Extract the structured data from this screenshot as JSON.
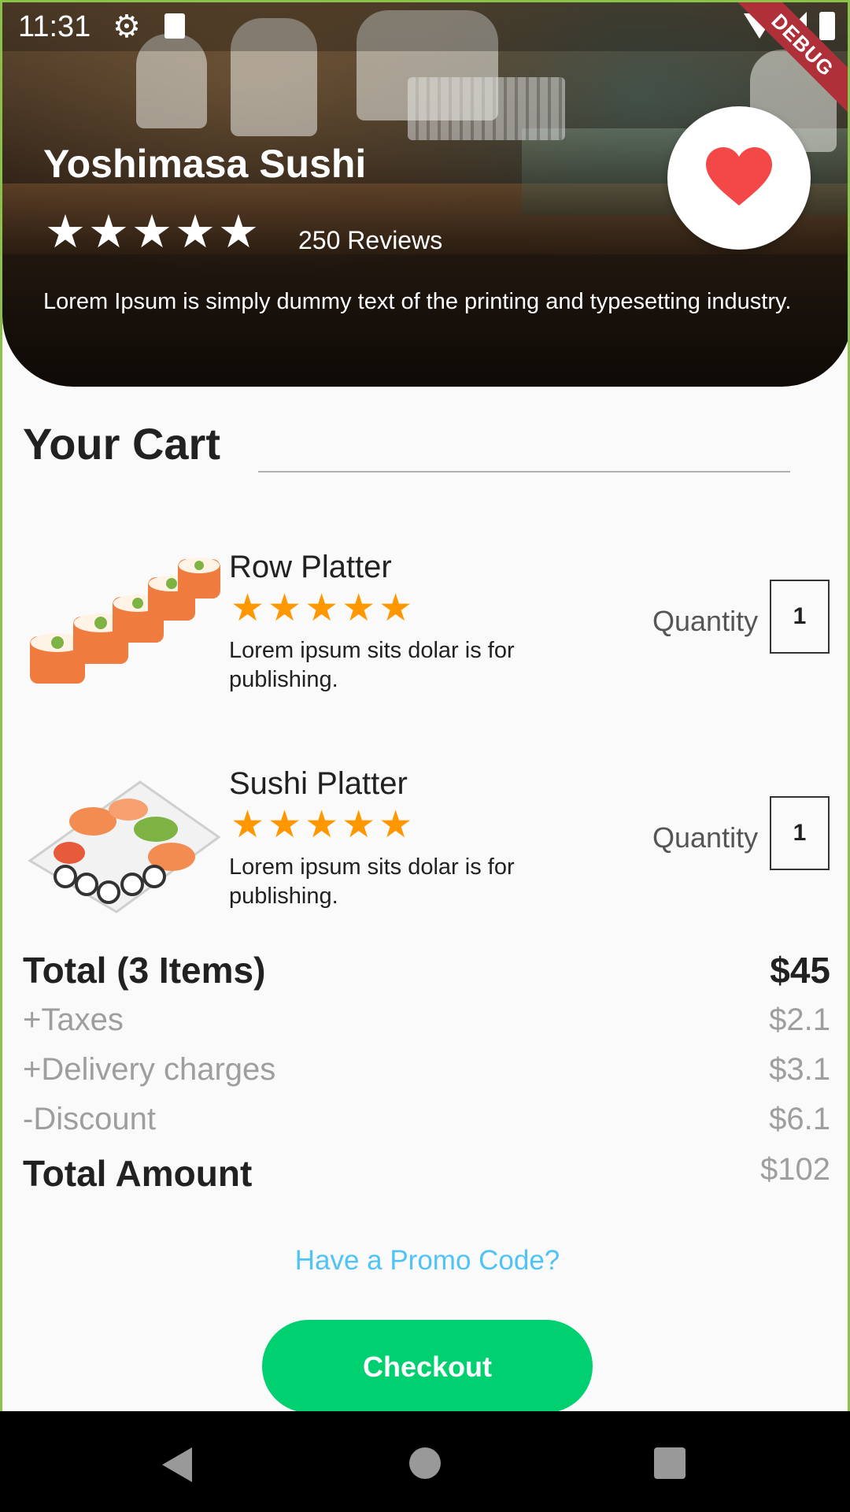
{
  "status_bar": {
    "time": "11:31"
  },
  "debug_banner": "DEBUG",
  "restaurant": {
    "name": "Yoshimasa Sushi",
    "rating": 5,
    "reviews": "250 Reviews",
    "description": "Lorem Ipsum is simply dummy text of the printing and typesetting industry."
  },
  "cart": {
    "title": "Your Cart",
    "quantity_label": "Quantity",
    "items": [
      {
        "name": "Row Platter",
        "rating": 5,
        "description": "Lorem ipsum sits dolar is for publishing.",
        "quantity": "1"
      },
      {
        "name": "Sushi Platter",
        "rating": 5,
        "description": "Lorem ipsum sits dolar is for publishing.",
        "quantity": "1"
      }
    ]
  },
  "summary": {
    "total_label": "Total (3 Items)",
    "total_value": "$45",
    "taxes_label": "+Taxes",
    "taxes_value": "$2.1",
    "delivery_label": "+Delivery charges",
    "delivery_value": "$3.1",
    "discount_label": "-Discount",
    "discount_value": "$6.1",
    "amount_label": "Total Amount",
    "amount_value": "$102"
  },
  "promo_link": "Have a Promo Code?",
  "checkout_label": "Checkout",
  "colors": {
    "accent_green": "#00d06f",
    "star_orange": "#ff9800",
    "heart_red": "#f44848",
    "promo_blue": "#4fc3f7"
  }
}
